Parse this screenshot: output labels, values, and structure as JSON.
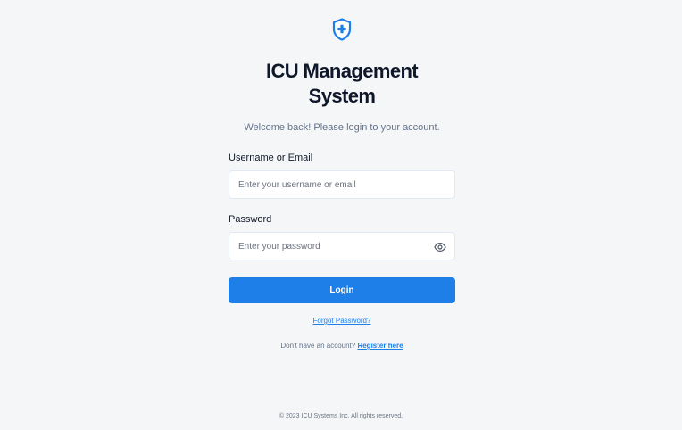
{
  "logo": {
    "icon": "shield-plus-icon",
    "color": "#1d7fe7"
  },
  "header": {
    "title": "ICU Management System",
    "subtitle": "Welcome back! Please login to your account."
  },
  "form": {
    "username": {
      "label": "Username or Email",
      "value": "",
      "placeholder": "Enter your username or email"
    },
    "password": {
      "label": "Password",
      "value": "",
      "placeholder": "Enter your password",
      "toggle_icon": "eye-icon"
    },
    "login_label": "Login",
    "forgot_label": "Forgot Password?",
    "register_prompt": "Don't have an account?",
    "register_label": "Register here"
  },
  "footer": {
    "text": "© 2023 ICU Systems Inc. All rights reserved."
  },
  "colors": {
    "accent": "#1d7fe7",
    "background": "#f4f6f8",
    "border": "#e2e8f0",
    "muted_text": "#64748b"
  }
}
